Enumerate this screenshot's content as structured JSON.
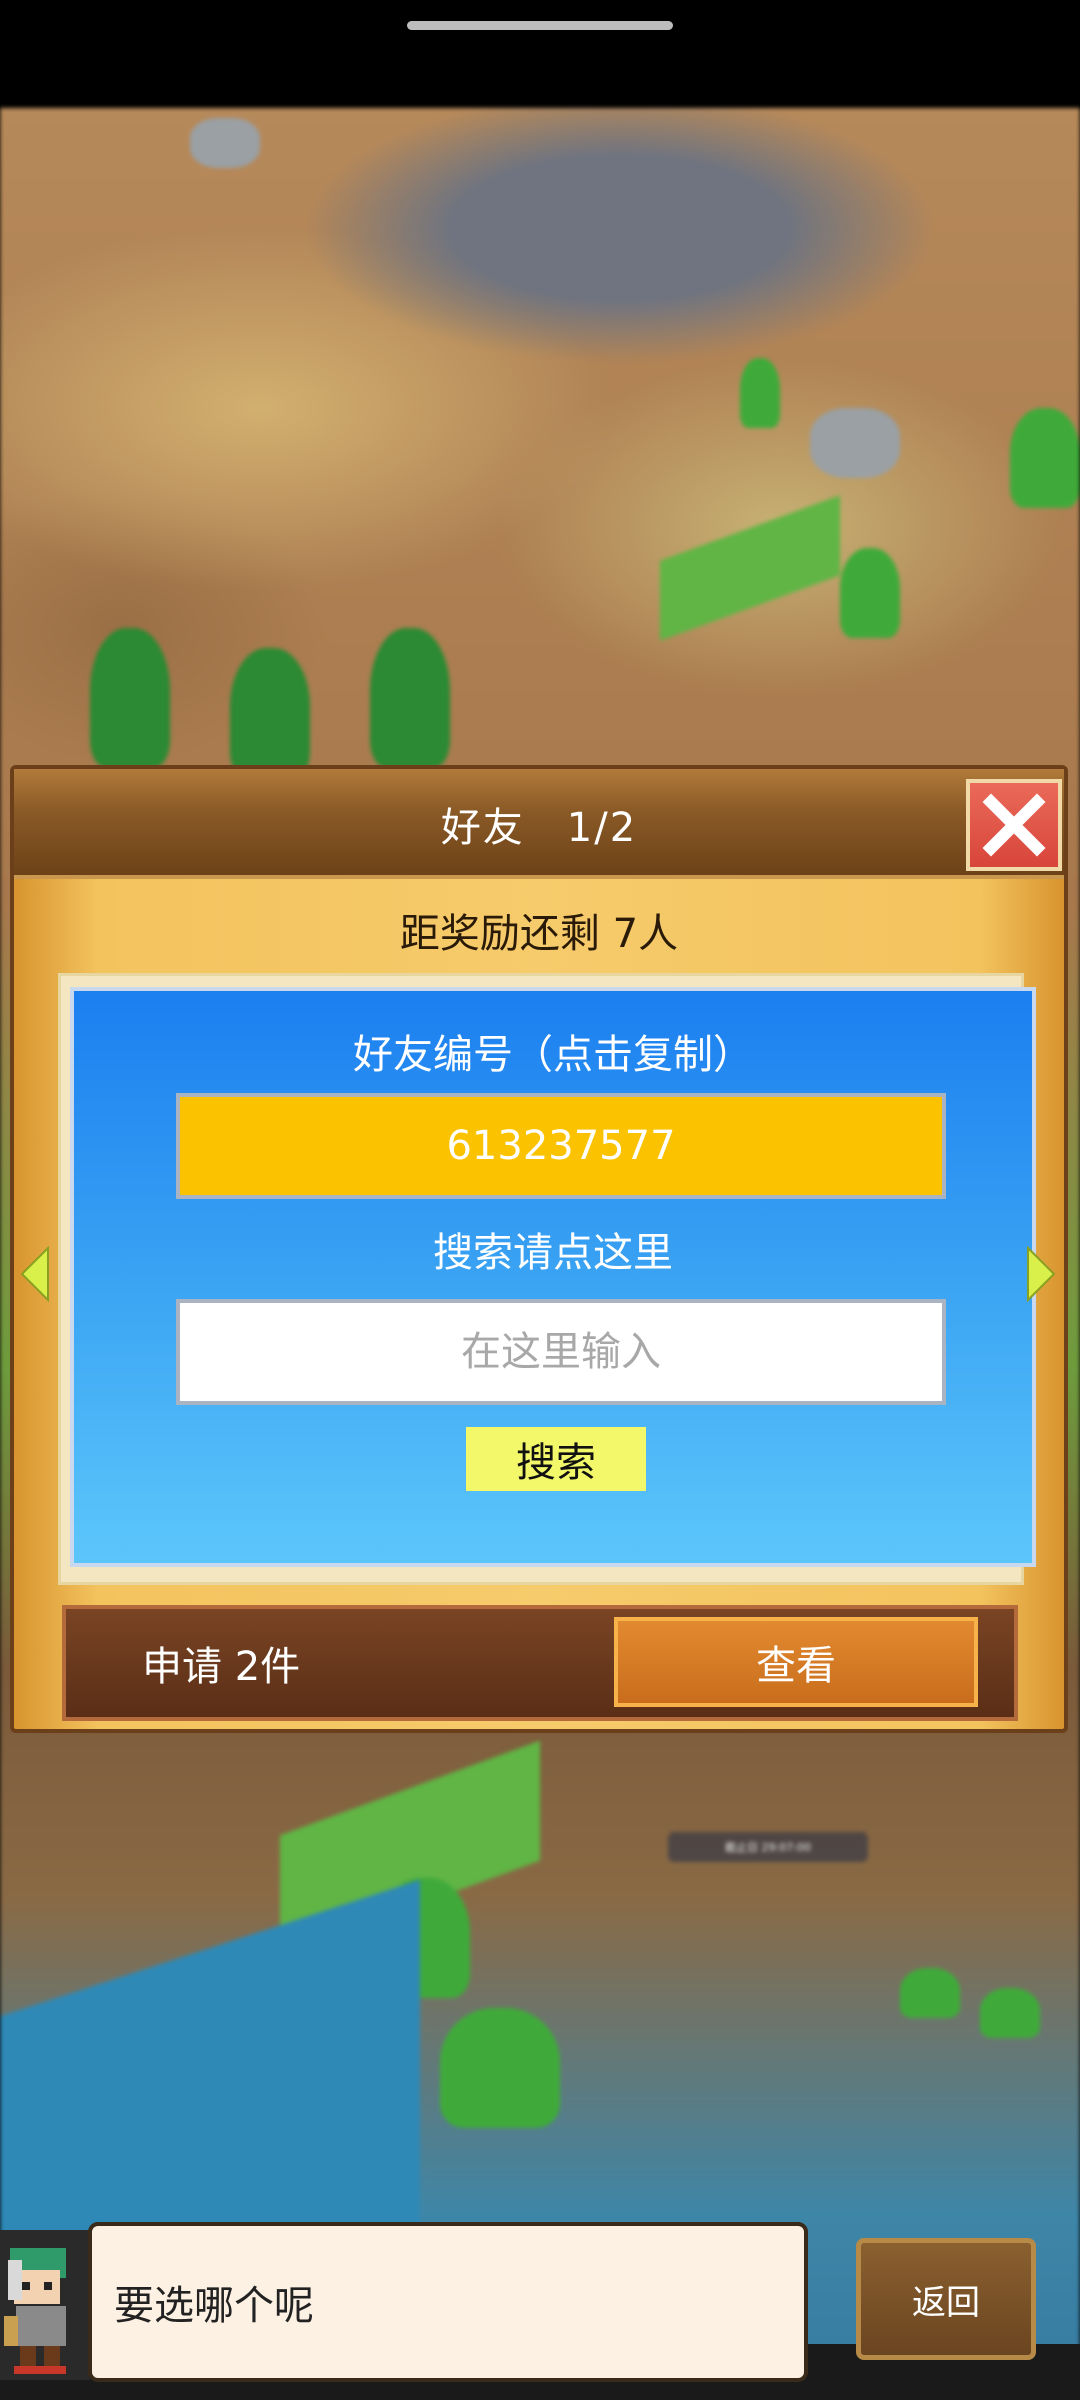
{
  "dialog": {
    "title": "好友　1/2",
    "reward_progress": "距奖励还剩 7人",
    "friend_id_label": "好友编号（点击复制）",
    "friend_id": "613237577",
    "search_hint": "搜索请点这里",
    "search_placeholder": "在这里输入",
    "search_button": "搜索",
    "requests_text": "申请 2件",
    "view_button": "查看"
  },
  "map_label": "截止日 29:07:00",
  "npc": {
    "speech": "要选哪个呢"
  },
  "back_button": "返回",
  "colors": {
    "panel_blue": "#1b7ff0",
    "id_box_yellow": "#fbc200",
    "search_button_yellow": "#f3f86a",
    "close_red": "#d8453a",
    "view_orange": "#e28a30"
  },
  "icons": {
    "close": "close-icon",
    "left_arrow": "left-arrow-icon",
    "right_arrow": "right-arrow-icon"
  }
}
